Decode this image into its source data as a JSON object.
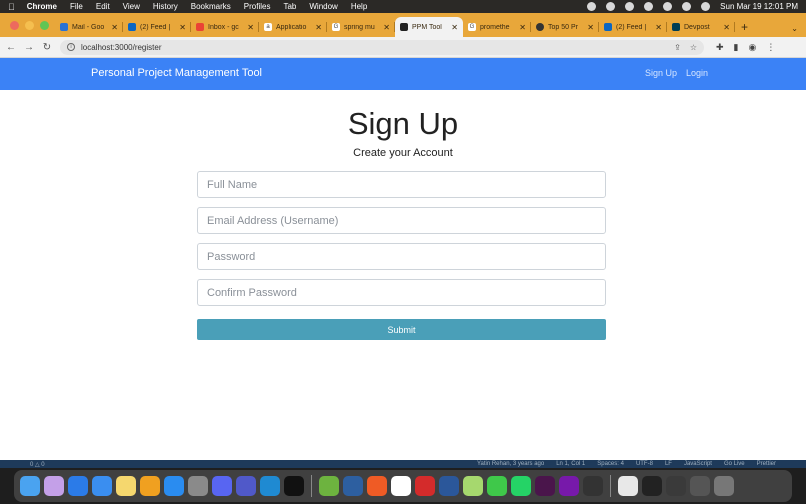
{
  "menubar": {
    "app": "Chrome",
    "items": [
      "File",
      "Edit",
      "View",
      "History",
      "Bookmarks",
      "Profiles",
      "Tab",
      "Window",
      "Help"
    ],
    "clock": "Sun Mar 19  12:01 PM"
  },
  "tabs": [
    {
      "label": "Mail - Goo",
      "icon": "outlook-icon"
    },
    {
      "label": "(2) Feed |",
      "icon": "linkedin-icon"
    },
    {
      "label": "Inbox - gc",
      "icon": "gmail-icon"
    },
    {
      "label": "Applicatio",
      "icon": "amazon-icon"
    },
    {
      "label": "spring mu",
      "icon": "google-icon"
    },
    {
      "label": "PPM Tool",
      "icon": "react-icon"
    },
    {
      "label": "promethe",
      "icon": "google-icon"
    },
    {
      "label": "Top 50 Pr",
      "icon": "globe-icon"
    },
    {
      "label": "(2) Feed |",
      "icon": "linkedin-icon"
    },
    {
      "label": "Devpost",
      "icon": "devpost-icon"
    }
  ],
  "address": {
    "url": "localhost:3000/register"
  },
  "navbar": {
    "brand": "Personal Project Management Tool",
    "signup": "Sign Up",
    "login": "Login"
  },
  "form": {
    "title": "Sign Up",
    "subtitle": "Create your Account",
    "fullname_placeholder": "Full Name",
    "email_placeholder": "Email Address (Username)",
    "password_placeholder": "Password",
    "confirm_placeholder": "Confirm Password",
    "submit_label": "Submit"
  },
  "statusbar": {
    "left": "0 △ 0",
    "author": "Yatin Rehan, 3 years ago",
    "position": "Ln 1, Col 1",
    "spaces": "Spaces: 4",
    "encoding": "UTF-8",
    "eol": "LF",
    "language": "JavaScript",
    "golive": "Go Live",
    "prettier": "Prettier"
  },
  "colors": {
    "navbar": "#3b82f6",
    "submit": "#4a9fb8",
    "tabstrip": "#e8a73a"
  }
}
